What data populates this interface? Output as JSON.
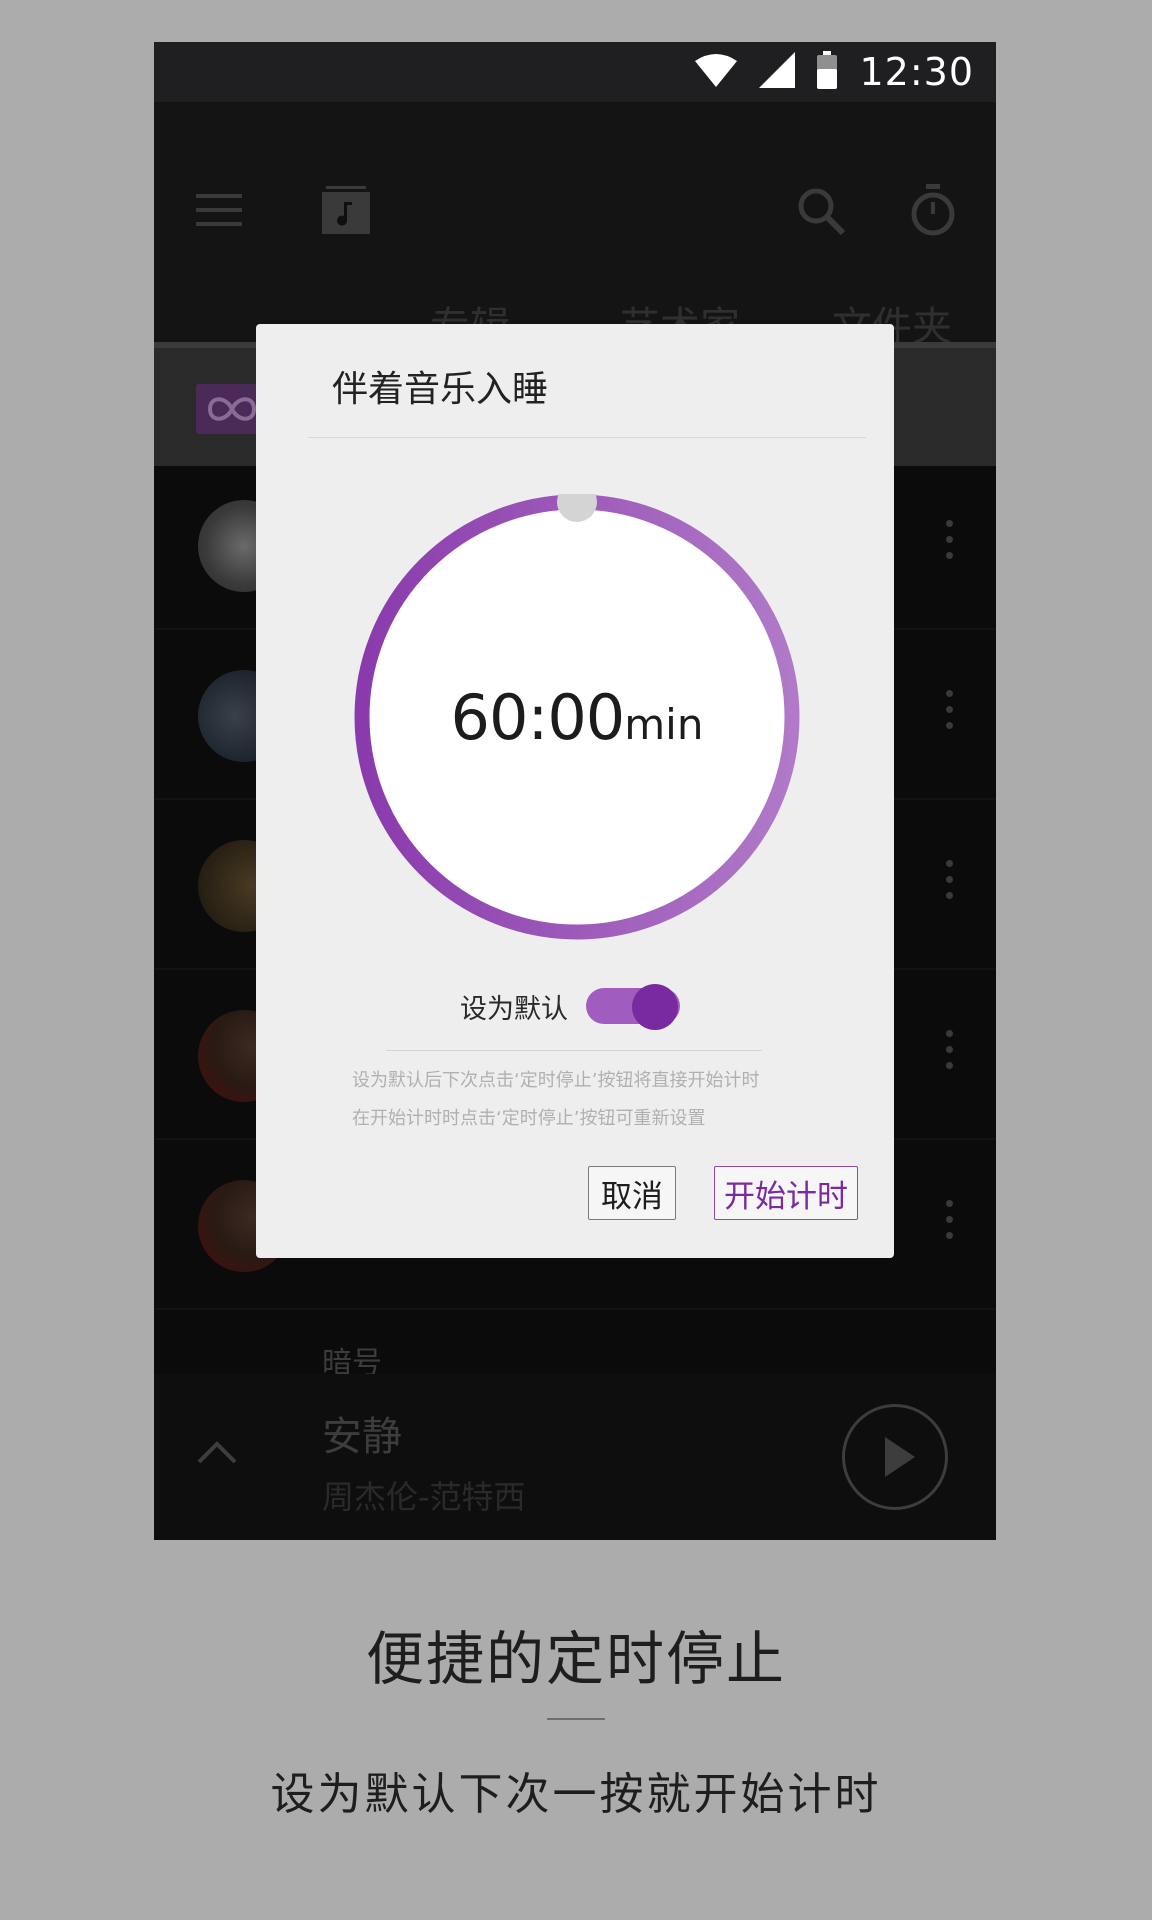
{
  "status_bar": {
    "time": "12:30",
    "icons": [
      "wifi-icon",
      "signal-icon",
      "battery-icon"
    ]
  },
  "app_bar": {
    "icons": [
      "menu-icon",
      "music-note-icon",
      "search-icon",
      "stopwatch-icon"
    ],
    "tabs": [
      "专辑",
      "艺术家",
      "文件夹"
    ]
  },
  "list": {
    "partial_item_title": "暗号"
  },
  "now_playing": {
    "title": "安静",
    "artist": "周杰伦-范特西"
  },
  "dialog": {
    "title": "伴着音乐入睡",
    "timer_value": "60:00",
    "timer_unit": "min",
    "timer_progress_fraction": 1.0,
    "default_label": "设为默认",
    "default_on": true,
    "hint_line1": "设为默认后下次点击‘定时停止’按钮将直接开始计时",
    "hint_line2": "在开始计时时点击‘定时停止’按钮可重新设置",
    "cancel_label": "取消",
    "start_label": "开始计时"
  },
  "caption": {
    "title": "便捷的定时停止",
    "subtitle": "设为默认下次一按就开始计时"
  },
  "colors": {
    "accent": "#7a2aa0",
    "accent_light": "#a05cbf",
    "page_bg": "#acacac"
  }
}
